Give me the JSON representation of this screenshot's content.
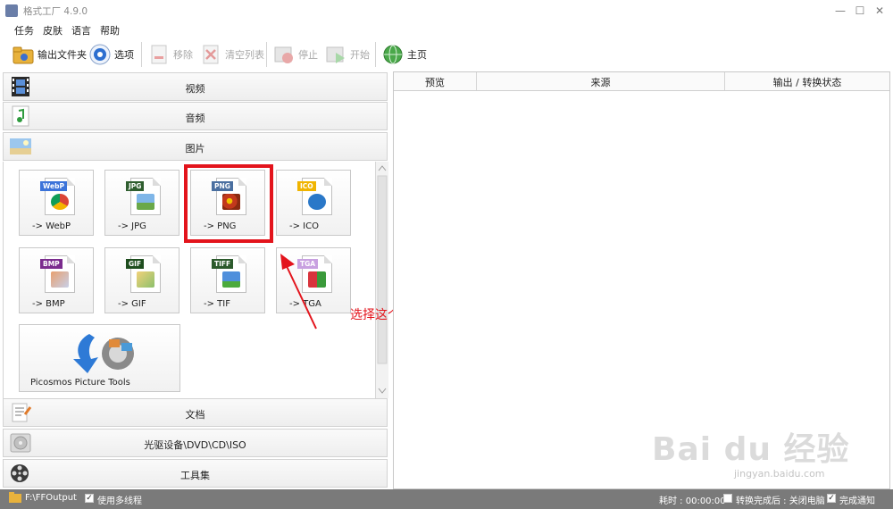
{
  "window": {
    "title": "格式工厂 4.9.0",
    "min": "—",
    "max": "☐",
    "close": "✕"
  },
  "menu": [
    "任务",
    "皮肤",
    "语言",
    "帮助"
  ],
  "toolbar": {
    "output_folder": "输出文件夹",
    "options": "选项",
    "remove": "移除",
    "clear_list": "清空列表",
    "stop": "停止",
    "start": "开始",
    "home": "主页"
  },
  "categories": {
    "video": "视频",
    "audio": "音频",
    "image": "图片",
    "document": "文档",
    "optical": "光驱设备\\DVD\\CD\\ISO",
    "tools": "工具集"
  },
  "tiles": [
    {
      "label": "-> WebP",
      "band": "WebP",
      "band_color": "#3b73d9",
      "icon": "webp-chrome-icon"
    },
    {
      "label": "-> JPG",
      "band": "JPG",
      "band_color": "#2f5e2f",
      "icon": "jpg-landscape-icon"
    },
    {
      "label": "-> PNG",
      "band": "PNG",
      "band_color": "#4a6fa0",
      "icon": "png-flower-icon"
    },
    {
      "label": "-> ICO",
      "band": "ICO",
      "band_color": "#f0b400",
      "icon": "ico-info-icon"
    },
    {
      "label": "-> BMP",
      "band": "BMP",
      "band_color": "#7b2c8e",
      "icon": "bmp-paint-icon"
    },
    {
      "label": "-> GIF",
      "band": "GIF",
      "band_color": "#1e4d1e",
      "icon": "gif-image-icon"
    },
    {
      "label": "-> TIF",
      "band": "TIFF",
      "band_color": "#2c5a2c",
      "icon": "tif-landscape-icon"
    },
    {
      "label": "-> TGA",
      "band": "TGA",
      "band_color": "#c8a0e0",
      "icon": "tga-cubes-icon"
    }
  ],
  "picosmos": {
    "label": "Picosmos Picture Tools"
  },
  "annotation": "选择这个转换png",
  "table": {
    "col_preview": "预览",
    "col_source": "来源",
    "col_status": "输出 / 转换状态"
  },
  "status": {
    "output_path": "F:\\FFOutput",
    "multithread": "使用多线程",
    "elapsed": "耗时 : 00:00:00",
    "after_done": "转换完成后 : 关闭电脑",
    "notify": "完成通知"
  },
  "watermark": {
    "logo": "Bai du 经验",
    "url": "jingyan.baidu.com"
  },
  "colors": {
    "accent_red": "#e3141c",
    "statusbar": "#7a7a7a"
  }
}
